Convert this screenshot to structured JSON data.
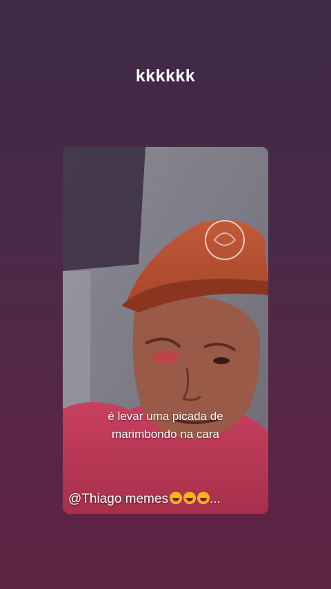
{
  "story": {
    "text": "kkkkkk"
  },
  "media": {
    "caption_line1": "é levar uma picada de",
    "caption_line2": "marimbondo na cara",
    "credit_handle": "@Thiago memes",
    "credit_emoji": "rolling-on-floor-laughing-icon",
    "credit_ellipsis": "..."
  },
  "colors": {
    "background_top": "#3d2a44",
    "background_bottom": "#5e2444",
    "text": "#ffffff",
    "cap": "#b8502f"
  }
}
